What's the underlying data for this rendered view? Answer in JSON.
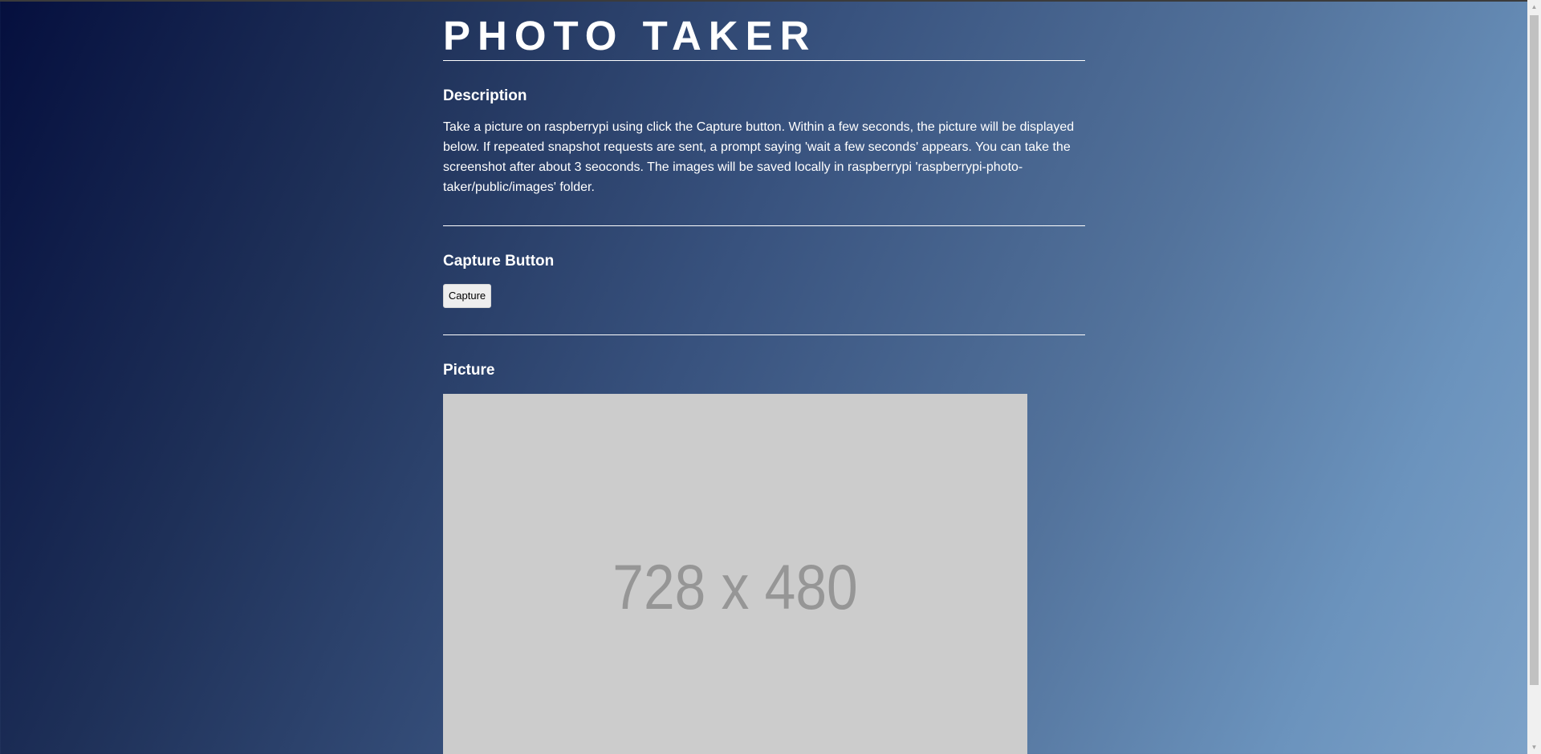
{
  "header": {
    "title": "PHOTO TAKER"
  },
  "description": {
    "heading": "Description",
    "text": "Take a picture on raspberrypi using click the Capture button. Within a few seconds, the picture will be displayed below. If repeated snapshot requests are sent, a prompt saying 'wait a few seconds' appears. You can take the screenshot after about 3 seoconds. The images will be saved locally in raspberrypi 'raspberrypi-photo-taker/public/images' folder."
  },
  "capture": {
    "heading": "Capture Button",
    "button_label": "Capture"
  },
  "picture": {
    "heading": "Picture",
    "placeholder_label": "728 x 480"
  },
  "icons": {
    "scroll_up": "chevron-up-icon",
    "scroll_down": "chevron-down-icon"
  },
  "colors": {
    "gradient_start": "#050f3e",
    "gradient_end": "#7ea3c9",
    "placeholder_bg": "#cccccc",
    "placeholder_text": "#969696"
  }
}
